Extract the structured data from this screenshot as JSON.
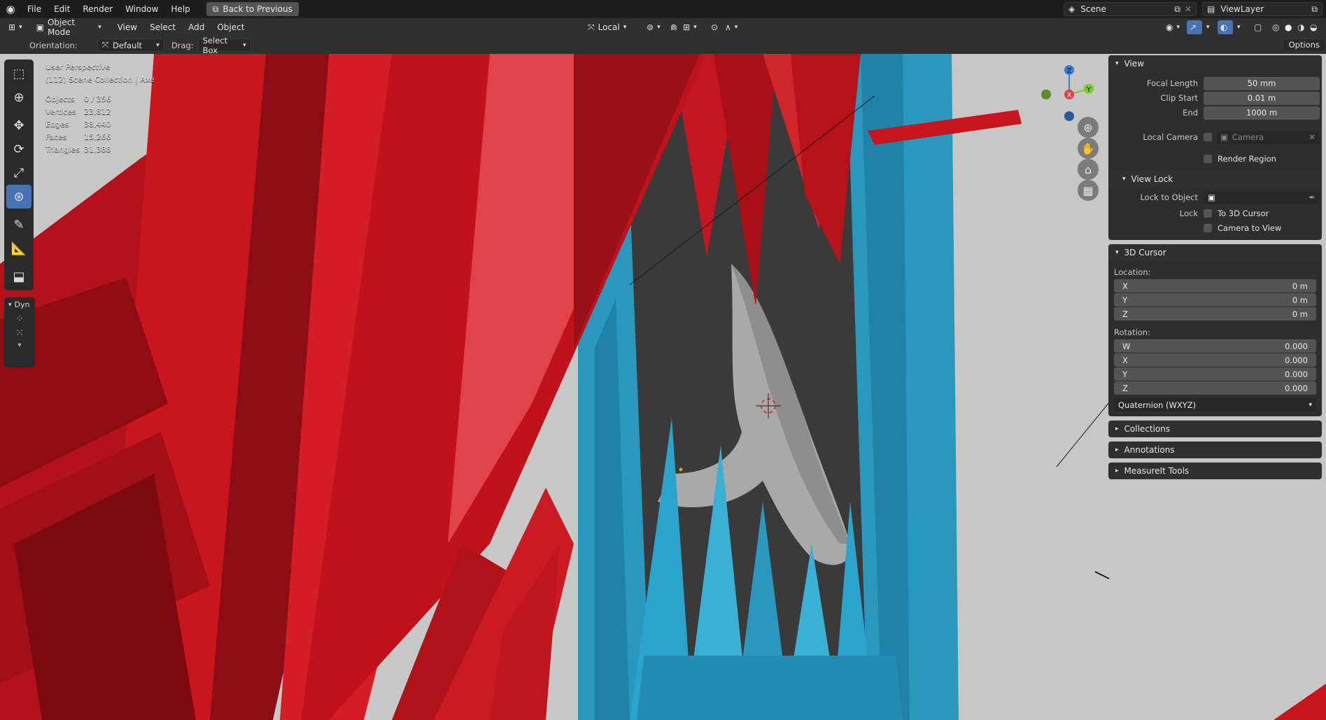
{
  "topbar": {
    "menus": [
      "File",
      "Edit",
      "Render",
      "Window",
      "Help"
    ],
    "back_button": "Back to Previous",
    "scene": "Scene",
    "view_layer": "ViewLayer"
  },
  "header": {
    "mode": "Object Mode",
    "menus": [
      "View",
      "Select",
      "Add",
      "Object"
    ],
    "transform_orientation": "Local"
  },
  "tool_settings": {
    "orientation_label": "Orientation:",
    "orientation_value": "Default",
    "drag_label": "Drag:",
    "drag_value": "Select Box",
    "options": "Options"
  },
  "overlay": {
    "perspective": "User Perspective",
    "collection": "(112) Scene Collection | Axe",
    "stats": [
      {
        "label": "Objects",
        "value": "0 / 356"
      },
      {
        "label": "Vertices",
        "value": "23,812"
      },
      {
        "label": "Edges",
        "value": "38,440"
      },
      {
        "label": "Faces",
        "value": "15,266"
      },
      {
        "label": "Triangles",
        "value": "31,388"
      }
    ]
  },
  "toolbar": {
    "dyn_label": "Dyn"
  },
  "gizmo": {
    "z": "Z",
    "x": "X",
    "y": "Y"
  },
  "npanel": {
    "view": {
      "title": "View",
      "focal_length_label": "Focal Length",
      "focal_length": "50 mm",
      "clip_start_label": "Clip Start",
      "clip_start": "0.01 m",
      "end_label": "End",
      "end": "1000 m",
      "local_camera_label": "Local Camera",
      "local_camera": "Camera",
      "render_region": "Render Region",
      "view_lock_title": "View Lock",
      "lock_to_object_label": "Lock to Object",
      "lock_label": "Lock",
      "to_3d_cursor": "To 3D Cursor",
      "camera_to_view": "Camera to View"
    },
    "cursor": {
      "title": "3D Cursor",
      "location_label": "Location:",
      "location": [
        {
          "axis": "X",
          "value": "0 m"
        },
        {
          "axis": "Y",
          "value": "0 m"
        },
        {
          "axis": "Z",
          "value": "0 m"
        }
      ],
      "rotation_label": "Rotation:",
      "rotation": [
        {
          "axis": "W",
          "value": "0.000"
        },
        {
          "axis": "X",
          "value": "0.000"
        },
        {
          "axis": "Y",
          "value": "0.000"
        },
        {
          "axis": "Z",
          "value": "0.000"
        }
      ],
      "rotation_mode": "Quaternion (WXYZ)"
    },
    "collapsed": [
      "Collections",
      "Annotations",
      "MeasureIt Tools"
    ]
  },
  "colors": {
    "accent": "#4772b3",
    "crystal_red": "#c8141c",
    "crystal_blue": "#2a9cc2",
    "background": "#c9c9c9"
  }
}
